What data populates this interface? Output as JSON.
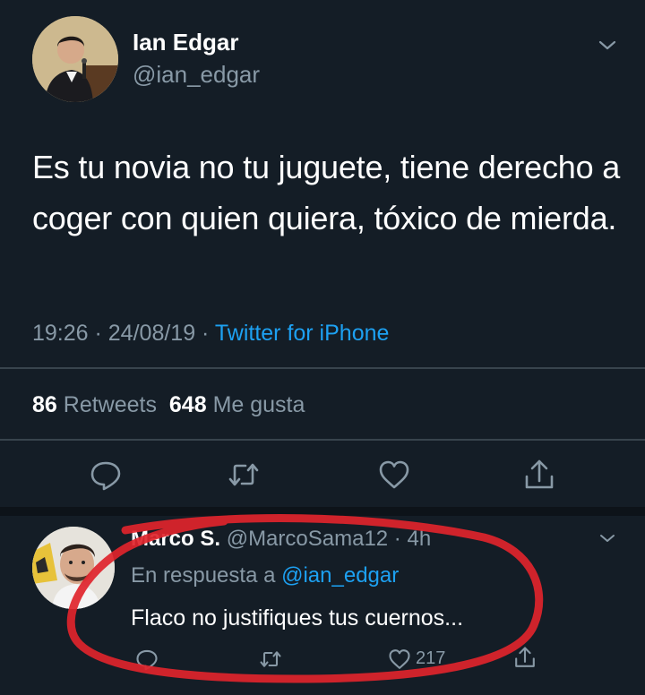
{
  "tweet": {
    "author_name": "Ian Edgar",
    "author_handle": "@ian_edgar",
    "text": "Es tu novia no tu juguete, tiene derecho a coger con quien quiera, tóxico de mierda.",
    "time": "19:26",
    "separator": " · ",
    "date": "24/08/19",
    "source": "Twitter for iPhone",
    "retweets_count": "86",
    "retweets_label": "Retweets",
    "likes_count": "648",
    "likes_label": "Me gusta"
  },
  "reply": {
    "author_name": "Marco S.",
    "author_handle": "@MarcoSama12 · 4h",
    "in_reply_prefix": "En respuesta a ",
    "in_reply_mention": "@ian_edgar",
    "text": "Flaco no justifiques tus cuernos...",
    "like_count": "217"
  },
  "icons": {
    "reply": "comment-icon",
    "retweet": "retweet-icon",
    "like": "heart-icon",
    "share": "share-icon",
    "menu": "chevron-down-icon"
  },
  "colors": {
    "background": "#141d26",
    "link": "#1da1f2",
    "secondary_text": "#8899a6",
    "annotation": "#e0242b"
  }
}
